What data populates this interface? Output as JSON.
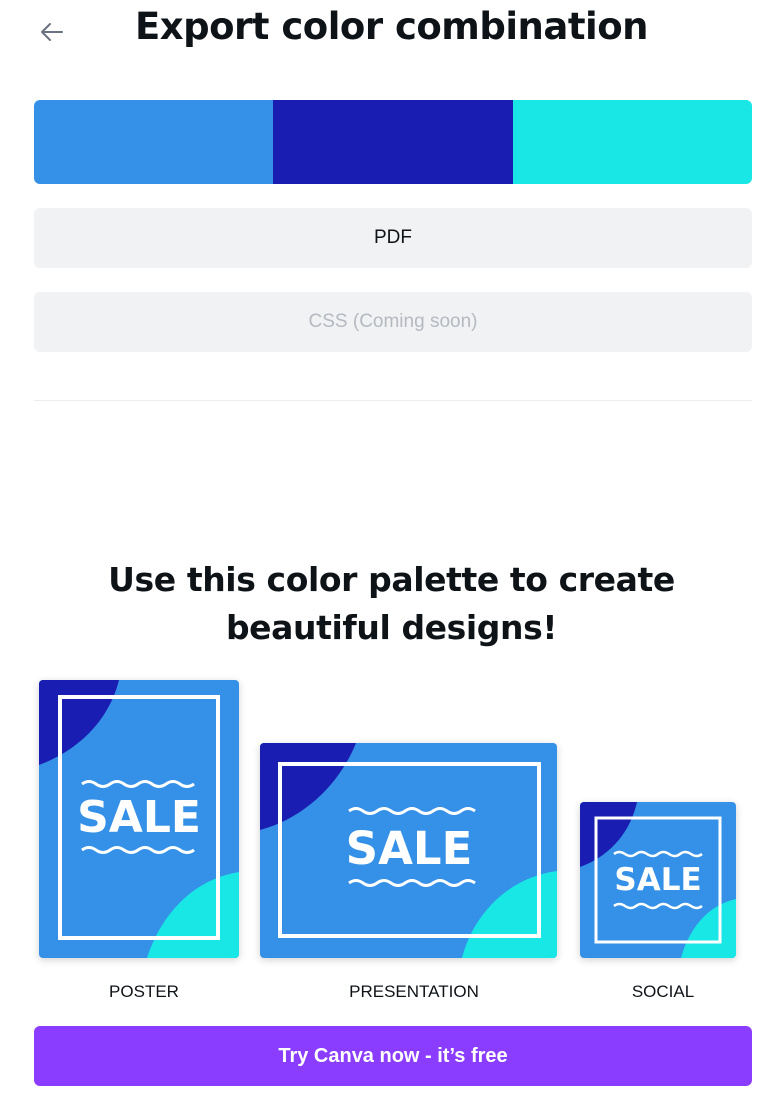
{
  "header": {
    "title": "Export color combination",
    "back_icon": "arrow-left-icon"
  },
  "palette": {
    "colors": [
      "#3591e7",
      "#1a1db1",
      "#18e7e5"
    ]
  },
  "export_options": {
    "pdf_label": "PDF",
    "css_label": "CSS (Coming soon)"
  },
  "promo": {
    "heading_line1": "Use this color palette to create",
    "heading_line2": "beautiful designs!"
  },
  "templates": [
    {
      "label": "POSTER",
      "sale_text": "SALE"
    },
    {
      "label": "PRESENTATION",
      "sale_text": "SALE"
    },
    {
      "label": "SOCIAL",
      "sale_text": "SALE"
    }
  ],
  "cta": {
    "label": "Try Canva now - it’s free",
    "color": "#8b3dff"
  }
}
